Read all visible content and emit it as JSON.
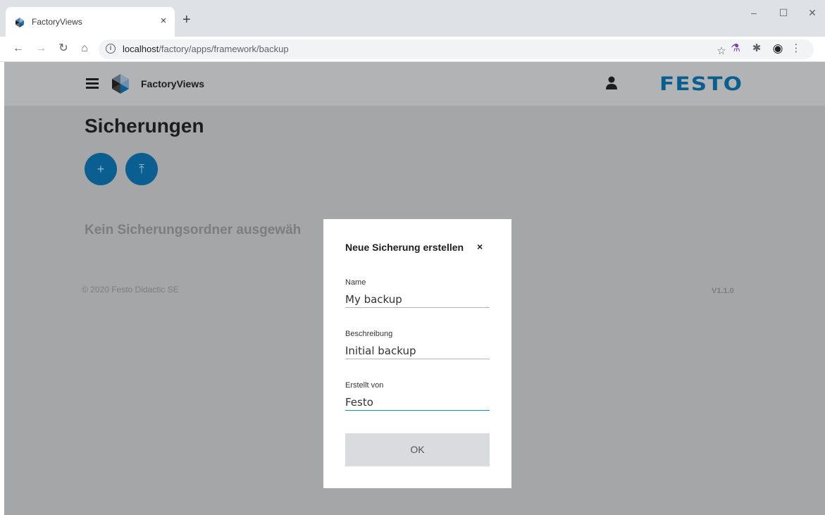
{
  "browser": {
    "tab_title": "FactoryViews",
    "tab_close": "×",
    "new_tab": "+",
    "url_host": "localhost",
    "url_path": "/factory/apps/framework/backup",
    "window_controls": {
      "minimize": "–",
      "maximize": "☐",
      "close": "✕"
    }
  },
  "app": {
    "name": "FactoryViews",
    "brand": "FESTO",
    "page_title": "Sicherungen",
    "add_button_icon": "+",
    "upload_button_icon": "⤒",
    "empty_message": "Kein Sicherungsordner ausgewäh",
    "copyright": "© 2020 Festo Didactic SE",
    "version": "V1.1.0"
  },
  "dialog": {
    "title": "Neue Sicherung erstellen",
    "close_icon": "×",
    "fields": [
      {
        "label": "Name",
        "value": "My backup"
      },
      {
        "label": "Beschreibung",
        "value": "Initial backup"
      },
      {
        "label": "Erstellt von",
        "value": "Festo"
      }
    ],
    "ok_label": "OK"
  },
  "colors": {
    "brand_blue": "#0b5e90",
    "overlay": "#a4a6a8",
    "focus_blue": "#0b8fd0"
  }
}
